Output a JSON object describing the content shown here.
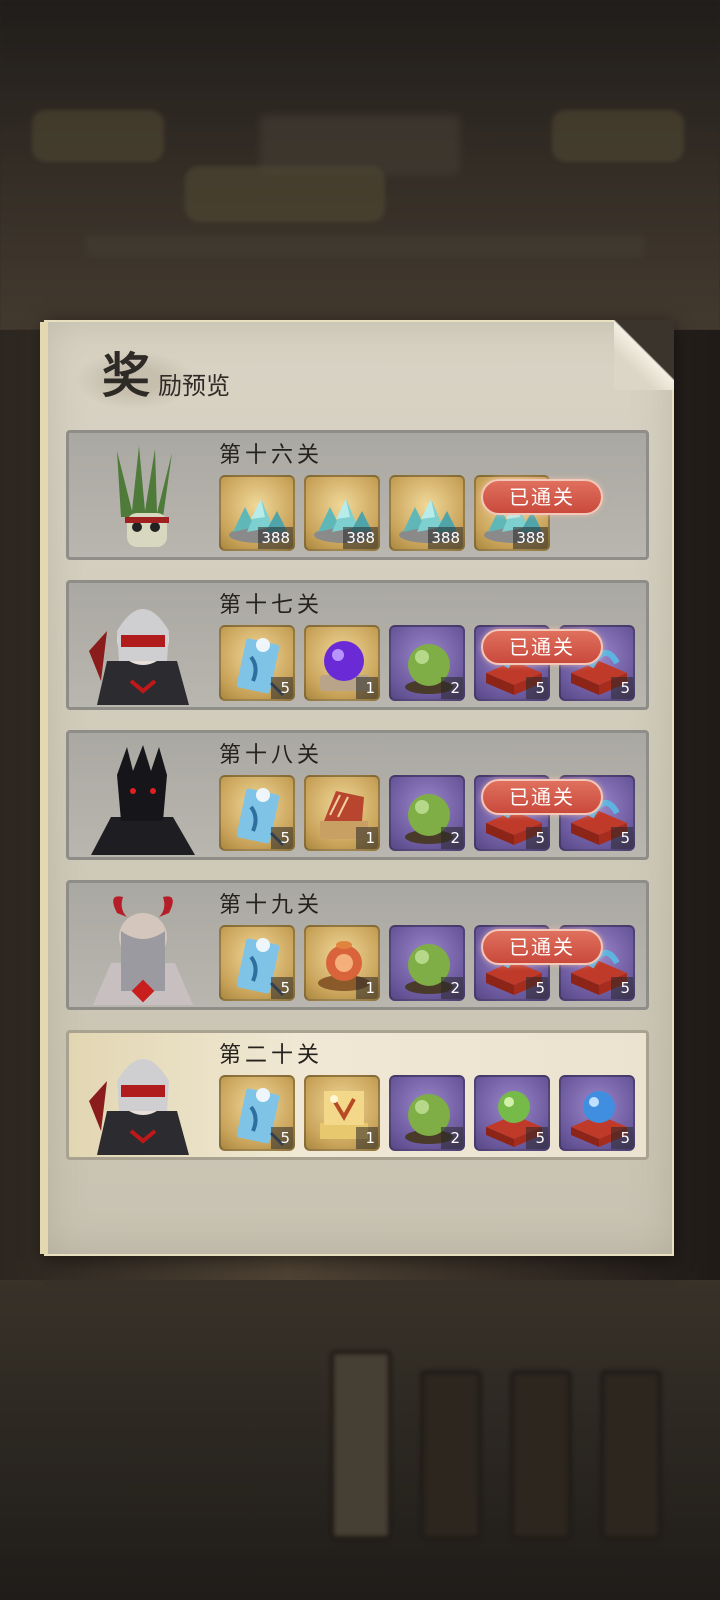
{
  "background": {
    "left_button": "",
    "right_button": "",
    "title": "",
    "tab_active": "",
    "tab_other": "",
    "info_line": ""
  },
  "panel": {
    "title_big": "奖",
    "title_small": "励预览"
  },
  "status": {
    "passed_label": "已通关"
  },
  "levels": [
    {
      "title": "第十六关",
      "boss": "grass-spirit",
      "passed": true,
      "rewards": [
        {
          "icon": "jade-crystal-icon",
          "count": "388",
          "frame": "gold"
        },
        {
          "icon": "jade-crystal-icon",
          "count": "388",
          "frame": "gold"
        },
        {
          "icon": "jade-crystal-icon",
          "count": "388",
          "frame": "gold"
        },
        {
          "icon": "jade-crystal-icon",
          "count": "388",
          "frame": "gold"
        }
      ]
    },
    {
      "title": "第十七关",
      "boss": "masked-swordsman",
      "passed": true,
      "rewards": [
        {
          "icon": "blue-scroll-icon",
          "count": "5",
          "frame": "gold"
        },
        {
          "icon": "purple-orb-icon",
          "count": "1",
          "frame": "gold"
        },
        {
          "icon": "green-orb-icon",
          "count": "2",
          "frame": "purple"
        },
        {
          "icon": "red-chest-icon",
          "count": "5",
          "frame": "purple"
        },
        {
          "icon": "red-chest-icon",
          "count": "5",
          "frame": "purple"
        }
      ]
    },
    {
      "title": "第十八关",
      "boss": "dark-knight",
      "passed": true,
      "rewards": [
        {
          "icon": "blue-scroll-icon",
          "count": "5",
          "frame": "gold"
        },
        {
          "icon": "red-book-icon",
          "count": "1",
          "frame": "gold"
        },
        {
          "icon": "green-orb-icon",
          "count": "2",
          "frame": "purple"
        },
        {
          "icon": "red-chest-icon",
          "count": "5",
          "frame": "purple"
        },
        {
          "icon": "red-chest-icon",
          "count": "5",
          "frame": "purple"
        }
      ]
    },
    {
      "title": "第十九关",
      "boss": "horned-elder",
      "passed": true,
      "rewards": [
        {
          "icon": "blue-scroll-icon",
          "count": "5",
          "frame": "gold"
        },
        {
          "icon": "red-lotus-icon",
          "count": "1",
          "frame": "gold"
        },
        {
          "icon": "green-orb-icon",
          "count": "2",
          "frame": "purple"
        },
        {
          "icon": "red-chest-icon",
          "count": "5",
          "frame": "purple"
        },
        {
          "icon": "red-chest-icon",
          "count": "5",
          "frame": "purple"
        }
      ]
    },
    {
      "title": "第二十关",
      "boss": "masked-swordsman",
      "passed": false,
      "rewards": [
        {
          "icon": "blue-scroll-icon",
          "count": "5",
          "frame": "gold"
        },
        {
          "icon": "gold-book-icon",
          "count": "1",
          "frame": "gold"
        },
        {
          "icon": "green-orb-icon",
          "count": "2",
          "frame": "purple"
        },
        {
          "icon": "green-chest-icon",
          "count": "5",
          "frame": "purple"
        },
        {
          "icon": "blue-chest-icon",
          "count": "5",
          "frame": "purple"
        }
      ]
    }
  ],
  "colors": {
    "passed_badge": "#d45a48",
    "gold_frame": "#d8b870",
    "purple_frame": "#7a68ae",
    "paper": "#d6d1c2"
  }
}
